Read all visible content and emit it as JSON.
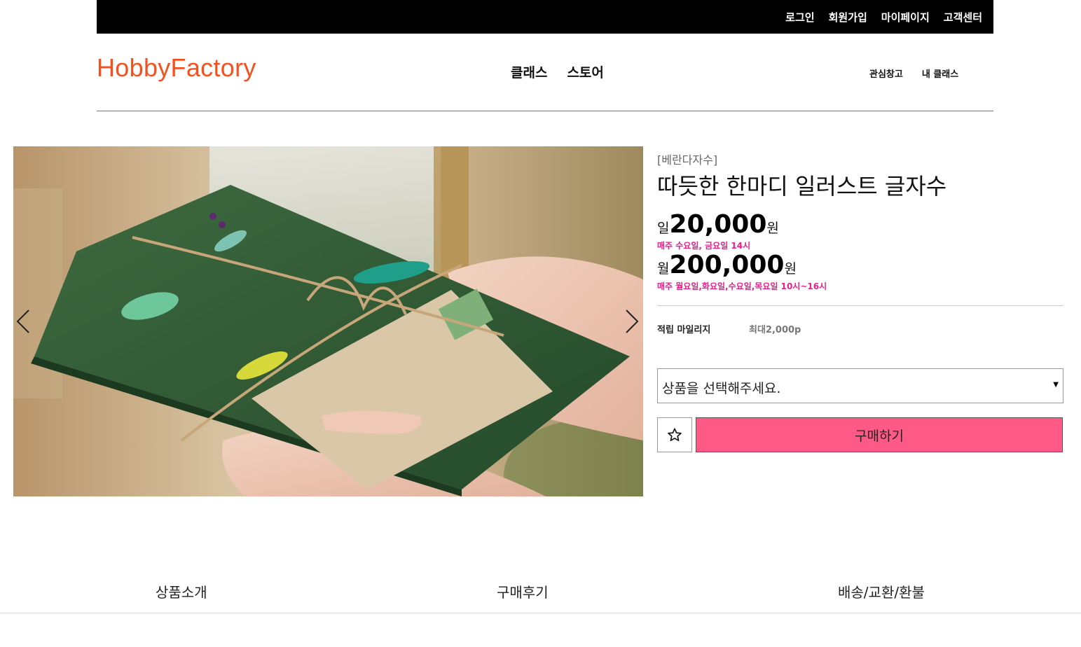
{
  "topbar": {
    "links": [
      "로그인",
      "회원가입",
      "마이페이지",
      "고객센터"
    ]
  },
  "header": {
    "logo": "HobbyFactory",
    "main_nav": [
      "클래스",
      "스토어"
    ],
    "user_nav": [
      "관심창고",
      "내 클래스"
    ]
  },
  "product": {
    "brand": "[베란다자수]",
    "title": "따듯한 한마디 일러스트 글자수",
    "prices": [
      {
        "prefix": "일",
        "amount": "20,000",
        "unit": "원",
        "schedule": "매주 수요일, 금요일 14시"
      },
      {
        "prefix": "월",
        "amount": "200,000",
        "unit": "원",
        "schedule": "매주 월요일,화요일,수요일,목요일 10시~16시"
      }
    ],
    "mileage_label": "적립 마일리지",
    "mileage_value": "최대2,000p",
    "select_placeholder": "상품을 선택해주세요.",
    "buy_label": "구매하기"
  },
  "tabs": [
    "상품소개",
    "구매후기",
    "배송/교환/환불"
  ],
  "colors": {
    "logo": "#f4511e",
    "buy_button": "#ff5a87",
    "schedule_text": "#e91e8c",
    "topbar": "#000000"
  },
  "icons": {
    "wishlist": "star-outline-icon",
    "carousel_prev": "chevron-left-icon",
    "carousel_next": "chevron-right-icon",
    "select_caret": "caret-down-icon"
  }
}
